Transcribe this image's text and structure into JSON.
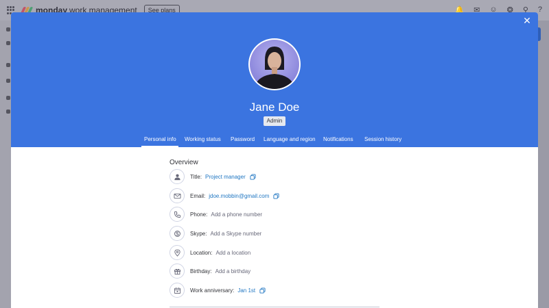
{
  "app": {
    "brand": "monday",
    "brand_sub": "work management",
    "see_plans": "See plans",
    "logo_colors": [
      "#e2445c",
      "#fdab3d",
      "#00c875"
    ]
  },
  "modal": {
    "close_icon": "close-icon",
    "user_name": "Jane Doe",
    "role_badge": "Admin",
    "header_color": "#3b74e0",
    "tabs": [
      {
        "label": "Personal info",
        "active": true
      },
      {
        "label": "Working status",
        "active": false
      },
      {
        "label": "Password",
        "active": false
      },
      {
        "label": "Language and region",
        "active": false
      },
      {
        "label": "Notifications",
        "active": false
      },
      {
        "label": "Session history",
        "active": false
      }
    ],
    "overview": {
      "title": "Overview",
      "rows": [
        {
          "icon": "person-icon",
          "label": "Title:",
          "value": "Project manager",
          "copy": true
        },
        {
          "icon": "email-icon",
          "label": "Email:",
          "value": "jdoe.mobbin@gmail.com",
          "copy": true
        },
        {
          "icon": "phone-icon",
          "label": "Phone:",
          "placeholder": "Add a phone number"
        },
        {
          "icon": "skype-icon",
          "label": "Skype:",
          "placeholder": "Add a Skype number"
        },
        {
          "icon": "location-icon",
          "label": "Location:",
          "placeholder": "Add a location"
        },
        {
          "icon": "gift-icon",
          "label": "Birthday:",
          "placeholder": "Add a birthday"
        },
        {
          "icon": "calendar-icon",
          "label": "Work anniversary:",
          "value": "Jan 1st",
          "copy": true
        }
      ]
    }
  }
}
